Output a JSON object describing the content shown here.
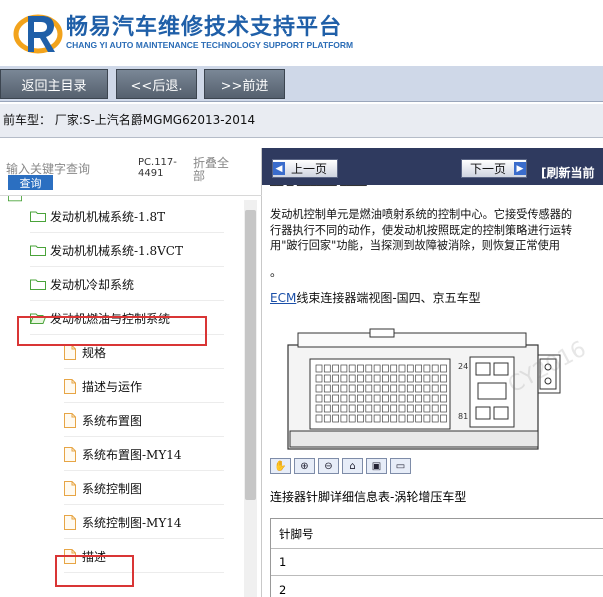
{
  "app": {
    "title_cn": "畅易汽车维修技术支持平台",
    "title_en": "CHANG YI AUTO MAINTENANCE TECHNOLOGY SUPPORT PLATFORM"
  },
  "nav": {
    "home": "返回主目录",
    "back": "<<后退.",
    "forward": ">>前进"
  },
  "car_line": "前车型：  厂家:S-上汽名爵MGMG62013-2014",
  "search": {
    "placeholder": "输入关键字查询",
    "button": "查询",
    "pc_code": "PC.117-4491",
    "fold_all": "折叠全部"
  },
  "tree": {
    "items": [
      {
        "label": "发动机机械系统-1.8T",
        "type": "folder"
      },
      {
        "label": "发动机机械系统-1.8VCT",
        "type": "folder"
      },
      {
        "label": "发动机冷却系统",
        "type": "folder"
      },
      {
        "label": "发动机燃油与控制系统",
        "type": "folder-open"
      },
      {
        "label": "规格",
        "type": "doc"
      },
      {
        "label": "描述与运作",
        "type": "doc"
      },
      {
        "label": "系统布置图",
        "type": "doc"
      },
      {
        "label": "系统布置图-MY14",
        "type": "doc"
      },
      {
        "label": "系统控制图",
        "type": "doc"
      },
      {
        "label": "系统控制图-MY14",
        "type": "doc"
      },
      {
        "label": "描述",
        "type": "doc"
      }
    ]
  },
  "doc": {
    "prev_page": "上一页",
    "next_page": "下一页",
    "refresh": "[刷新当前",
    "para_line1": "发动机控制单元是燃油喷射系统的控制中心。它接受传感器的",
    "para_line2": "行器执行不同的动作，使发动机按照既定的控制策略进行运转",
    "para_line3": "用\"跛行回家\"功能，当探测到故障被消除，则恢复正常使用",
    "dot": "。",
    "ecm_link": "ECM",
    "ecm_rest": "线束连接器端视图-国四、京五车型",
    "pin_label_24": "24",
    "pin_label_81": "81",
    "pin_table_title": "连接器针脚详细信息表-涡轮增压车型",
    "pin_header": "针脚号",
    "pin_rows": [
      "1",
      "2"
    ]
  },
  "colors": {
    "brand_blue": "#1f5fa8",
    "highlight_red": "#d93535",
    "toolbar_dark": "#2f3a5f"
  }
}
